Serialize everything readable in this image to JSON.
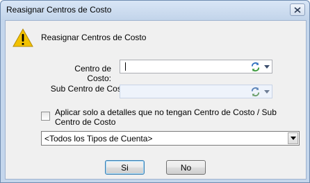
{
  "window": {
    "title": "Reasignar Centros de Costo",
    "close_icon": "close-icon"
  },
  "header": {
    "icon": "warning-icon",
    "text": "Reasignar Centros de Costo"
  },
  "centro": {
    "label": "Centro de Costo:",
    "value": "",
    "icon": "refresh-icon"
  },
  "sub_centro": {
    "label": "Sub Centro de Costo:",
    "value": "",
    "icon": "refresh-icon"
  },
  "checkbox": {
    "label": "Aplicar solo a detalles que no tengan Centro de Costo / Sub Centro de Costo",
    "checked": false
  },
  "tipo_cuenta": {
    "selected": "<Todos los Tipos de Cuenta>"
  },
  "buttons": {
    "si": "Si",
    "no": "No"
  },
  "colors": {
    "title_bar": "#c4d6ec",
    "client_bg": "#f0f0f0",
    "warning": "#f2c200"
  }
}
